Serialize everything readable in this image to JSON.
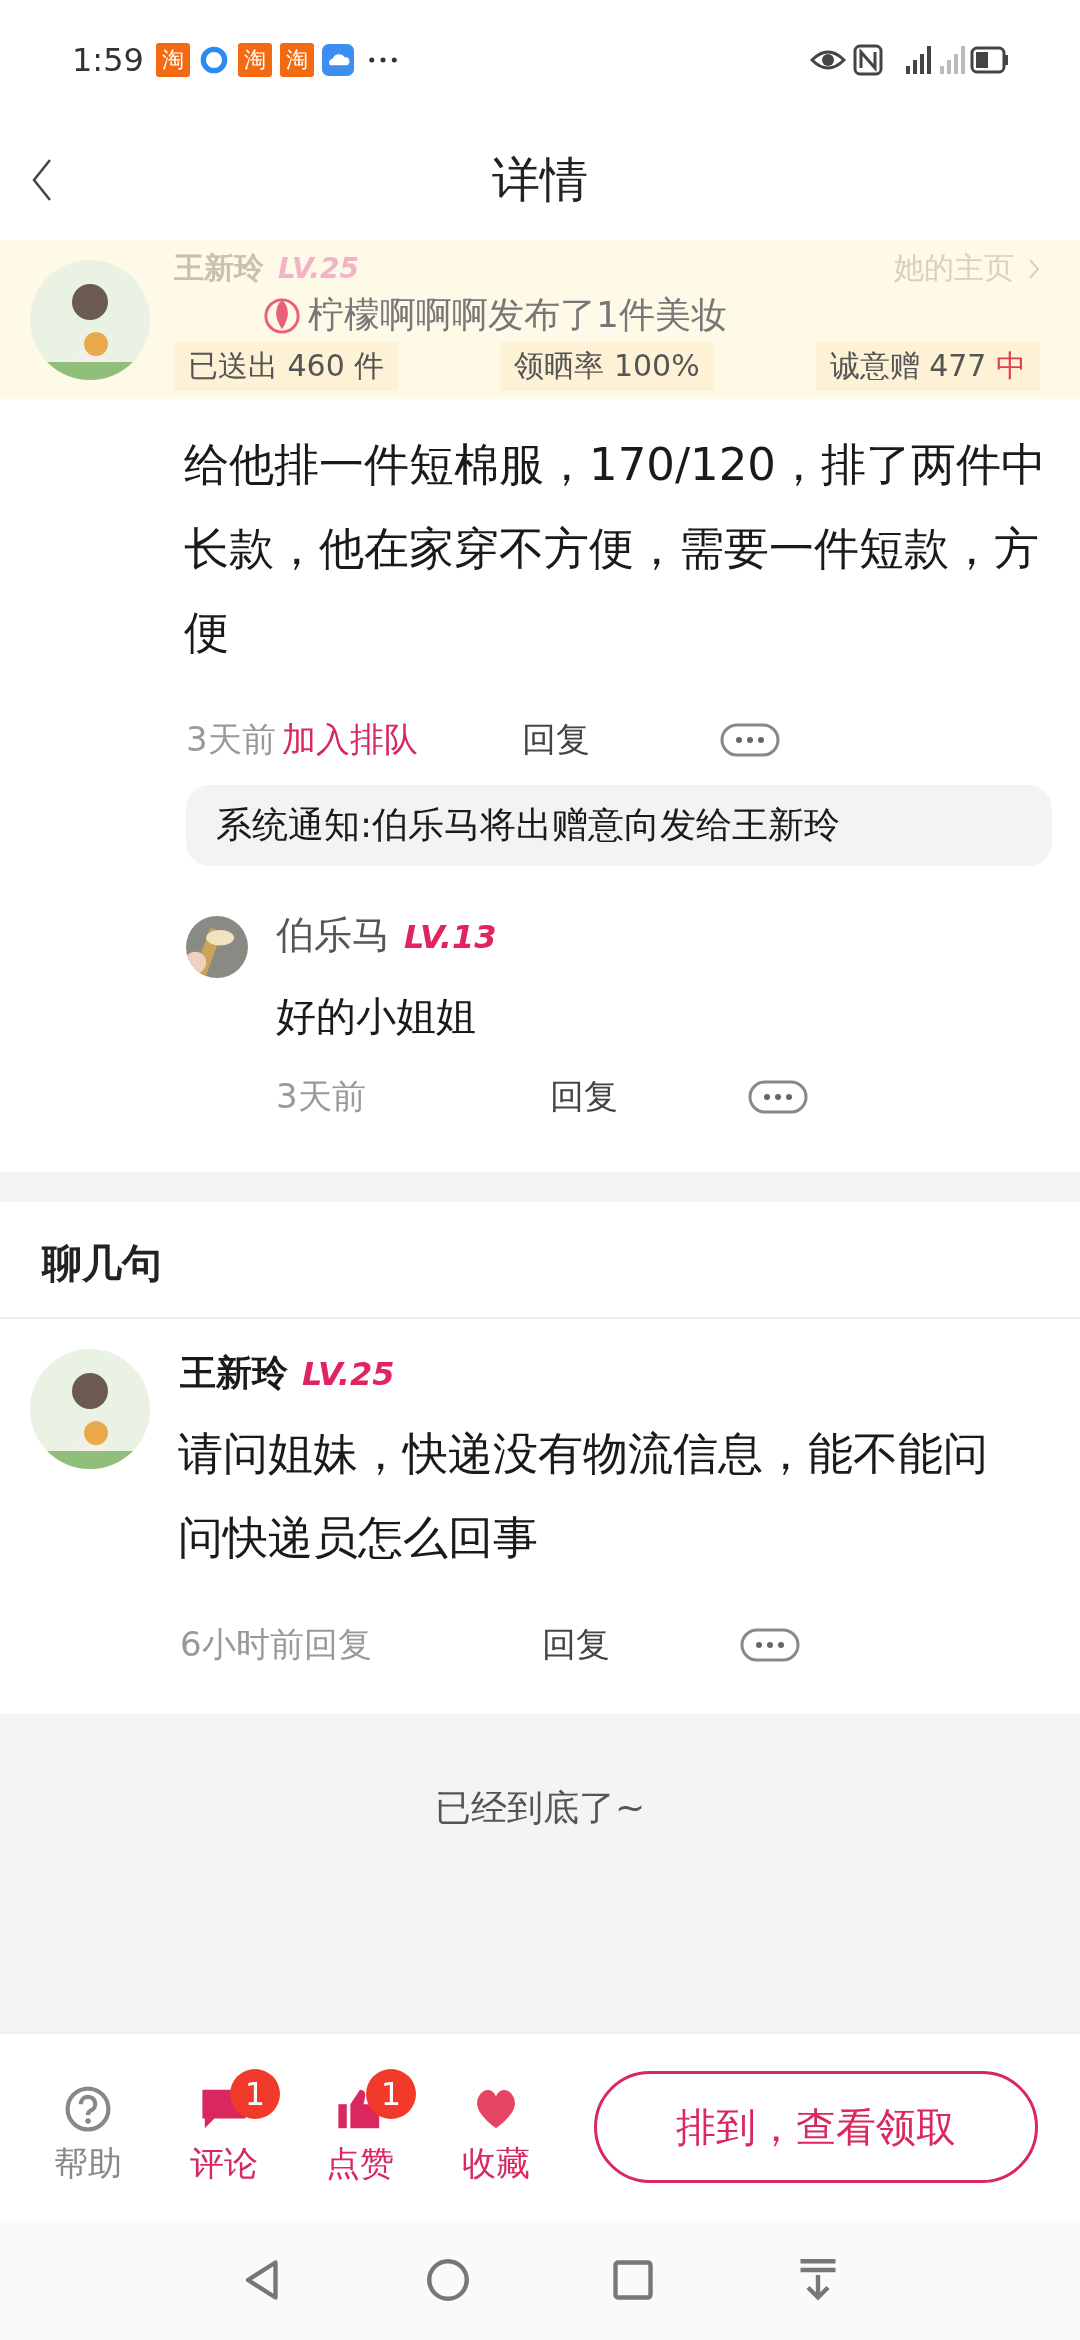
{
  "status_bar": {
    "time": "1:59",
    "notif_badges": [
      "淘",
      "淘",
      "淘"
    ]
  },
  "header": {
    "title": "详情"
  },
  "poster": {
    "name": "王新玲",
    "level": "LV.25",
    "home_link": "她的主页",
    "toast": "柠檬啊啊啊发布了1件美妆",
    "stats": [
      {
        "text": "已送出 460 件"
      },
      {
        "text": "领晒率 100%"
      },
      {
        "text": "诚意赠 477 ",
        "tag": "中"
      }
    ]
  },
  "comment": {
    "text": "给他排一件短棉服，170/120，排了两件中长款，他在家穿不方便，需要一件短款，方便",
    "time": "3天前",
    "action": "加入排队",
    "reply": "回复",
    "notice": "系统通知:伯乐马将出赠意向发给王新玲",
    "replies": [
      {
        "name": "伯乐马",
        "level": "LV.13",
        "text": "好的小姐姐",
        "time": "3天前",
        "reply": "回复"
      }
    ]
  },
  "chat": {
    "title": "聊几句",
    "items": [
      {
        "name": "王新玲",
        "level": "LV.25",
        "text": "请问姐妹，快递没有物流信息，能不能问问快递员怎么回事",
        "time": "6小时前回复",
        "reply": "回复"
      }
    ]
  },
  "end_text": "已经到底了~",
  "bottom_bar": {
    "actions": [
      {
        "kind": "help",
        "label": "帮助",
        "active": false
      },
      {
        "kind": "comment",
        "label": "评论",
        "active": true,
        "badge": "1"
      },
      {
        "kind": "like",
        "label": "点赞",
        "active": true,
        "badge": "1"
      },
      {
        "kind": "fav",
        "label": "收藏",
        "active": true
      }
    ],
    "cta": "排到，查看领取"
  }
}
